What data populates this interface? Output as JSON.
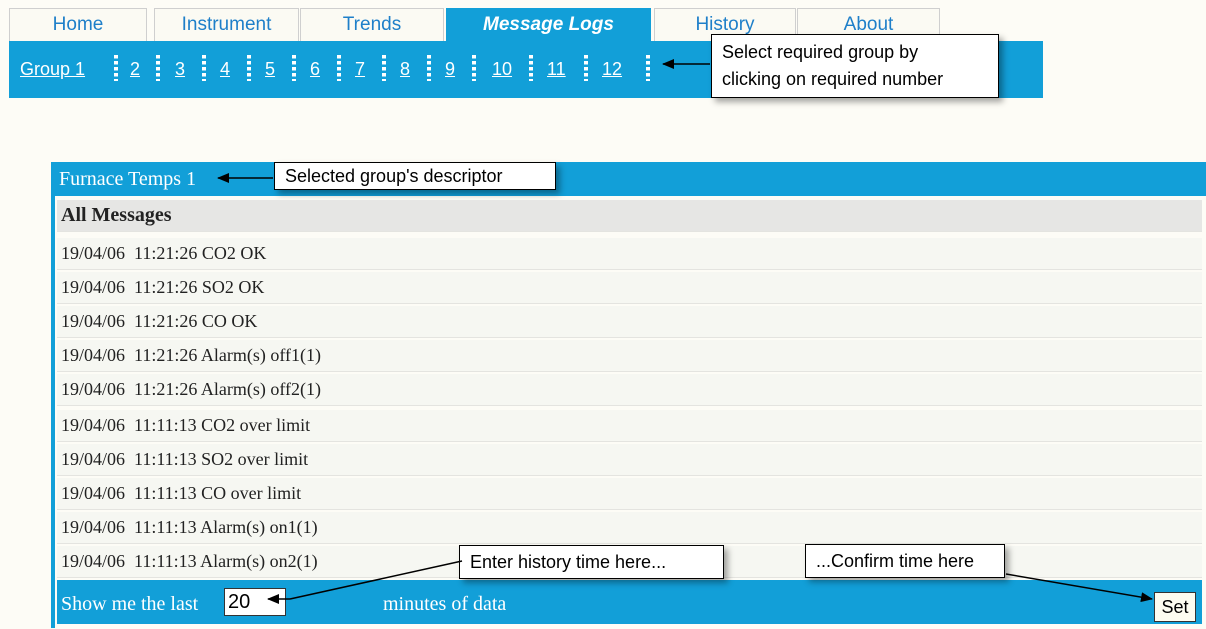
{
  "tabs": [
    {
      "label": "Home"
    },
    {
      "label": "Instrument"
    },
    {
      "label": "Trends"
    },
    {
      "label": "Message Logs"
    },
    {
      "label": "History"
    },
    {
      "label": "About"
    }
  ],
  "active_tab": "Message Logs",
  "groups": [
    "Group 1",
    "2",
    "3",
    "4",
    "5",
    "6",
    "7",
    "8",
    "9",
    "10",
    "11",
    "12"
  ],
  "callouts": {
    "group_select_line1": "Select required group by",
    "group_select_line2": "clicking on required number",
    "descriptor": "Selected group's descriptor",
    "history_time": "Enter history time here...",
    "confirm_time": "...Confirm time here"
  },
  "panel": {
    "title": "Furnace Temps 1",
    "header": "All Messages",
    "messages": [
      "19/04/06  11:21:26 CO2 OK",
      "19/04/06  11:21:26 SO2 OK",
      "19/04/06  11:21:26 CO OK",
      "19/04/06  11:21:26 Alarm(s) off1(1)",
      "19/04/06  11:21:26 Alarm(s) off2(1)",
      "19/04/06  11:11:13 CO2 over limit",
      "19/04/06  11:11:13 SO2 over limit",
      "19/04/06  11:11:13 CO over limit",
      "19/04/06  11:11:13 Alarm(s) on1(1)",
      "19/04/06  11:11:13 Alarm(s) on2(1)"
    ]
  },
  "footer": {
    "prefix": "Show me the last",
    "minutes_value": "20",
    "suffix": "minutes of data",
    "set_label": "Set"
  },
  "colors": {
    "accent": "#129fd8",
    "tab_text": "#1e7fc9",
    "background": "#fdfcf6"
  }
}
